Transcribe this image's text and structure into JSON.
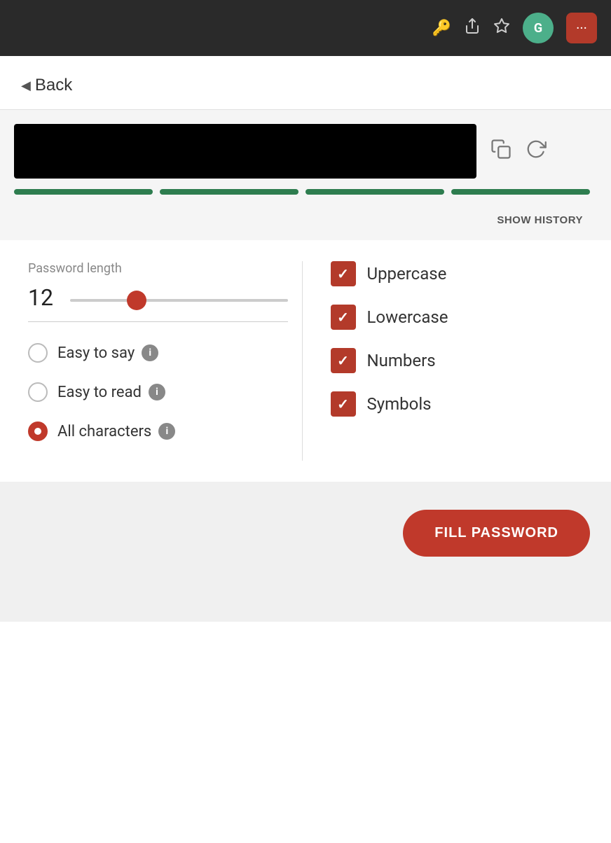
{
  "browser": {
    "icons": {
      "key": "🔑",
      "share": "⬆",
      "star": "☆",
      "grammarly": "G",
      "more": "···"
    }
  },
  "back": {
    "label": "Back"
  },
  "password": {
    "strength_bars": 4,
    "show_history_label": "SHOW HISTORY"
  },
  "settings": {
    "length_label": "Password length",
    "length_value": "12",
    "slider_min": 4,
    "slider_max": 32,
    "slider_value": 12,
    "character_sets": {
      "options": [
        {
          "id": "easy-to-say",
          "label": "Easy to say",
          "info": true,
          "selected": false
        },
        {
          "id": "easy-to-read",
          "label": "Easy to read",
          "info": true,
          "selected": false
        },
        {
          "id": "all-characters",
          "label": "All characters",
          "info": true,
          "selected": true
        }
      ],
      "checkboxes": [
        {
          "id": "uppercase",
          "label": "Uppercase",
          "checked": true
        },
        {
          "id": "lowercase",
          "label": "Lowercase",
          "checked": true
        },
        {
          "id": "numbers",
          "label": "Numbers",
          "checked": true
        },
        {
          "id": "symbols",
          "label": "Symbols",
          "checked": true
        }
      ]
    }
  },
  "fill_button": {
    "label": "FILL PASSWORD"
  }
}
